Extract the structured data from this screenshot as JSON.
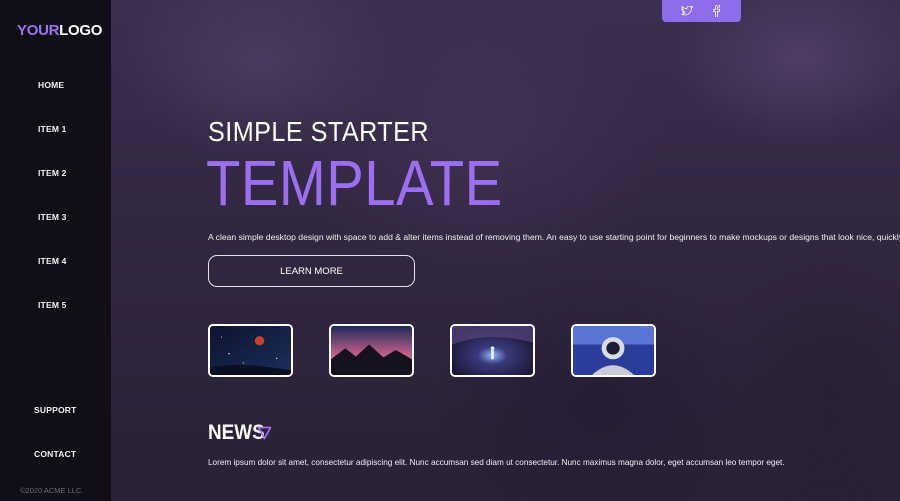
{
  "logo": {
    "accent": "YOUR",
    "plain": "LOGO"
  },
  "nav": {
    "items": [
      "HOME",
      "ITEM 1",
      "ITEM 2",
      "ITEM 3",
      "ITEM 4",
      "ITEM 5"
    ],
    "bottom": [
      "SUPPORT",
      "CONTACT"
    ]
  },
  "footer": {
    "copyright": "©2020 ACME LLC."
  },
  "social": {
    "icons": [
      "twitter-icon",
      "facebook-icon"
    ]
  },
  "hero": {
    "subtitle": "SIMPLE STARTER",
    "title": "TEMPLATE",
    "description": "A clean simple desktop design with space to add & alter items instead of removing them. An easy to use starting point for beginners to make mockups or designs that look nice, quickly.",
    "button": "LEARN MORE"
  },
  "gallery": {
    "thumbnails": [
      "red-moon-night-sky",
      "pink-sky-mountains",
      "night-person-light",
      "astronaut-helmet"
    ]
  },
  "news": {
    "title": "NEWS",
    "icon": "triangle-down-icon",
    "text": "Lorem ipsum dolor sit amet, consectetur adipiscing elit. Nunc accumsan sed diam ut consectetur. Nunc maximus magna dolor, eget accumsan leo tempor eget."
  },
  "colors": {
    "accent": "#9a6ff0",
    "sidebar": "#120e18",
    "social_bar": "#8f6cea"
  }
}
